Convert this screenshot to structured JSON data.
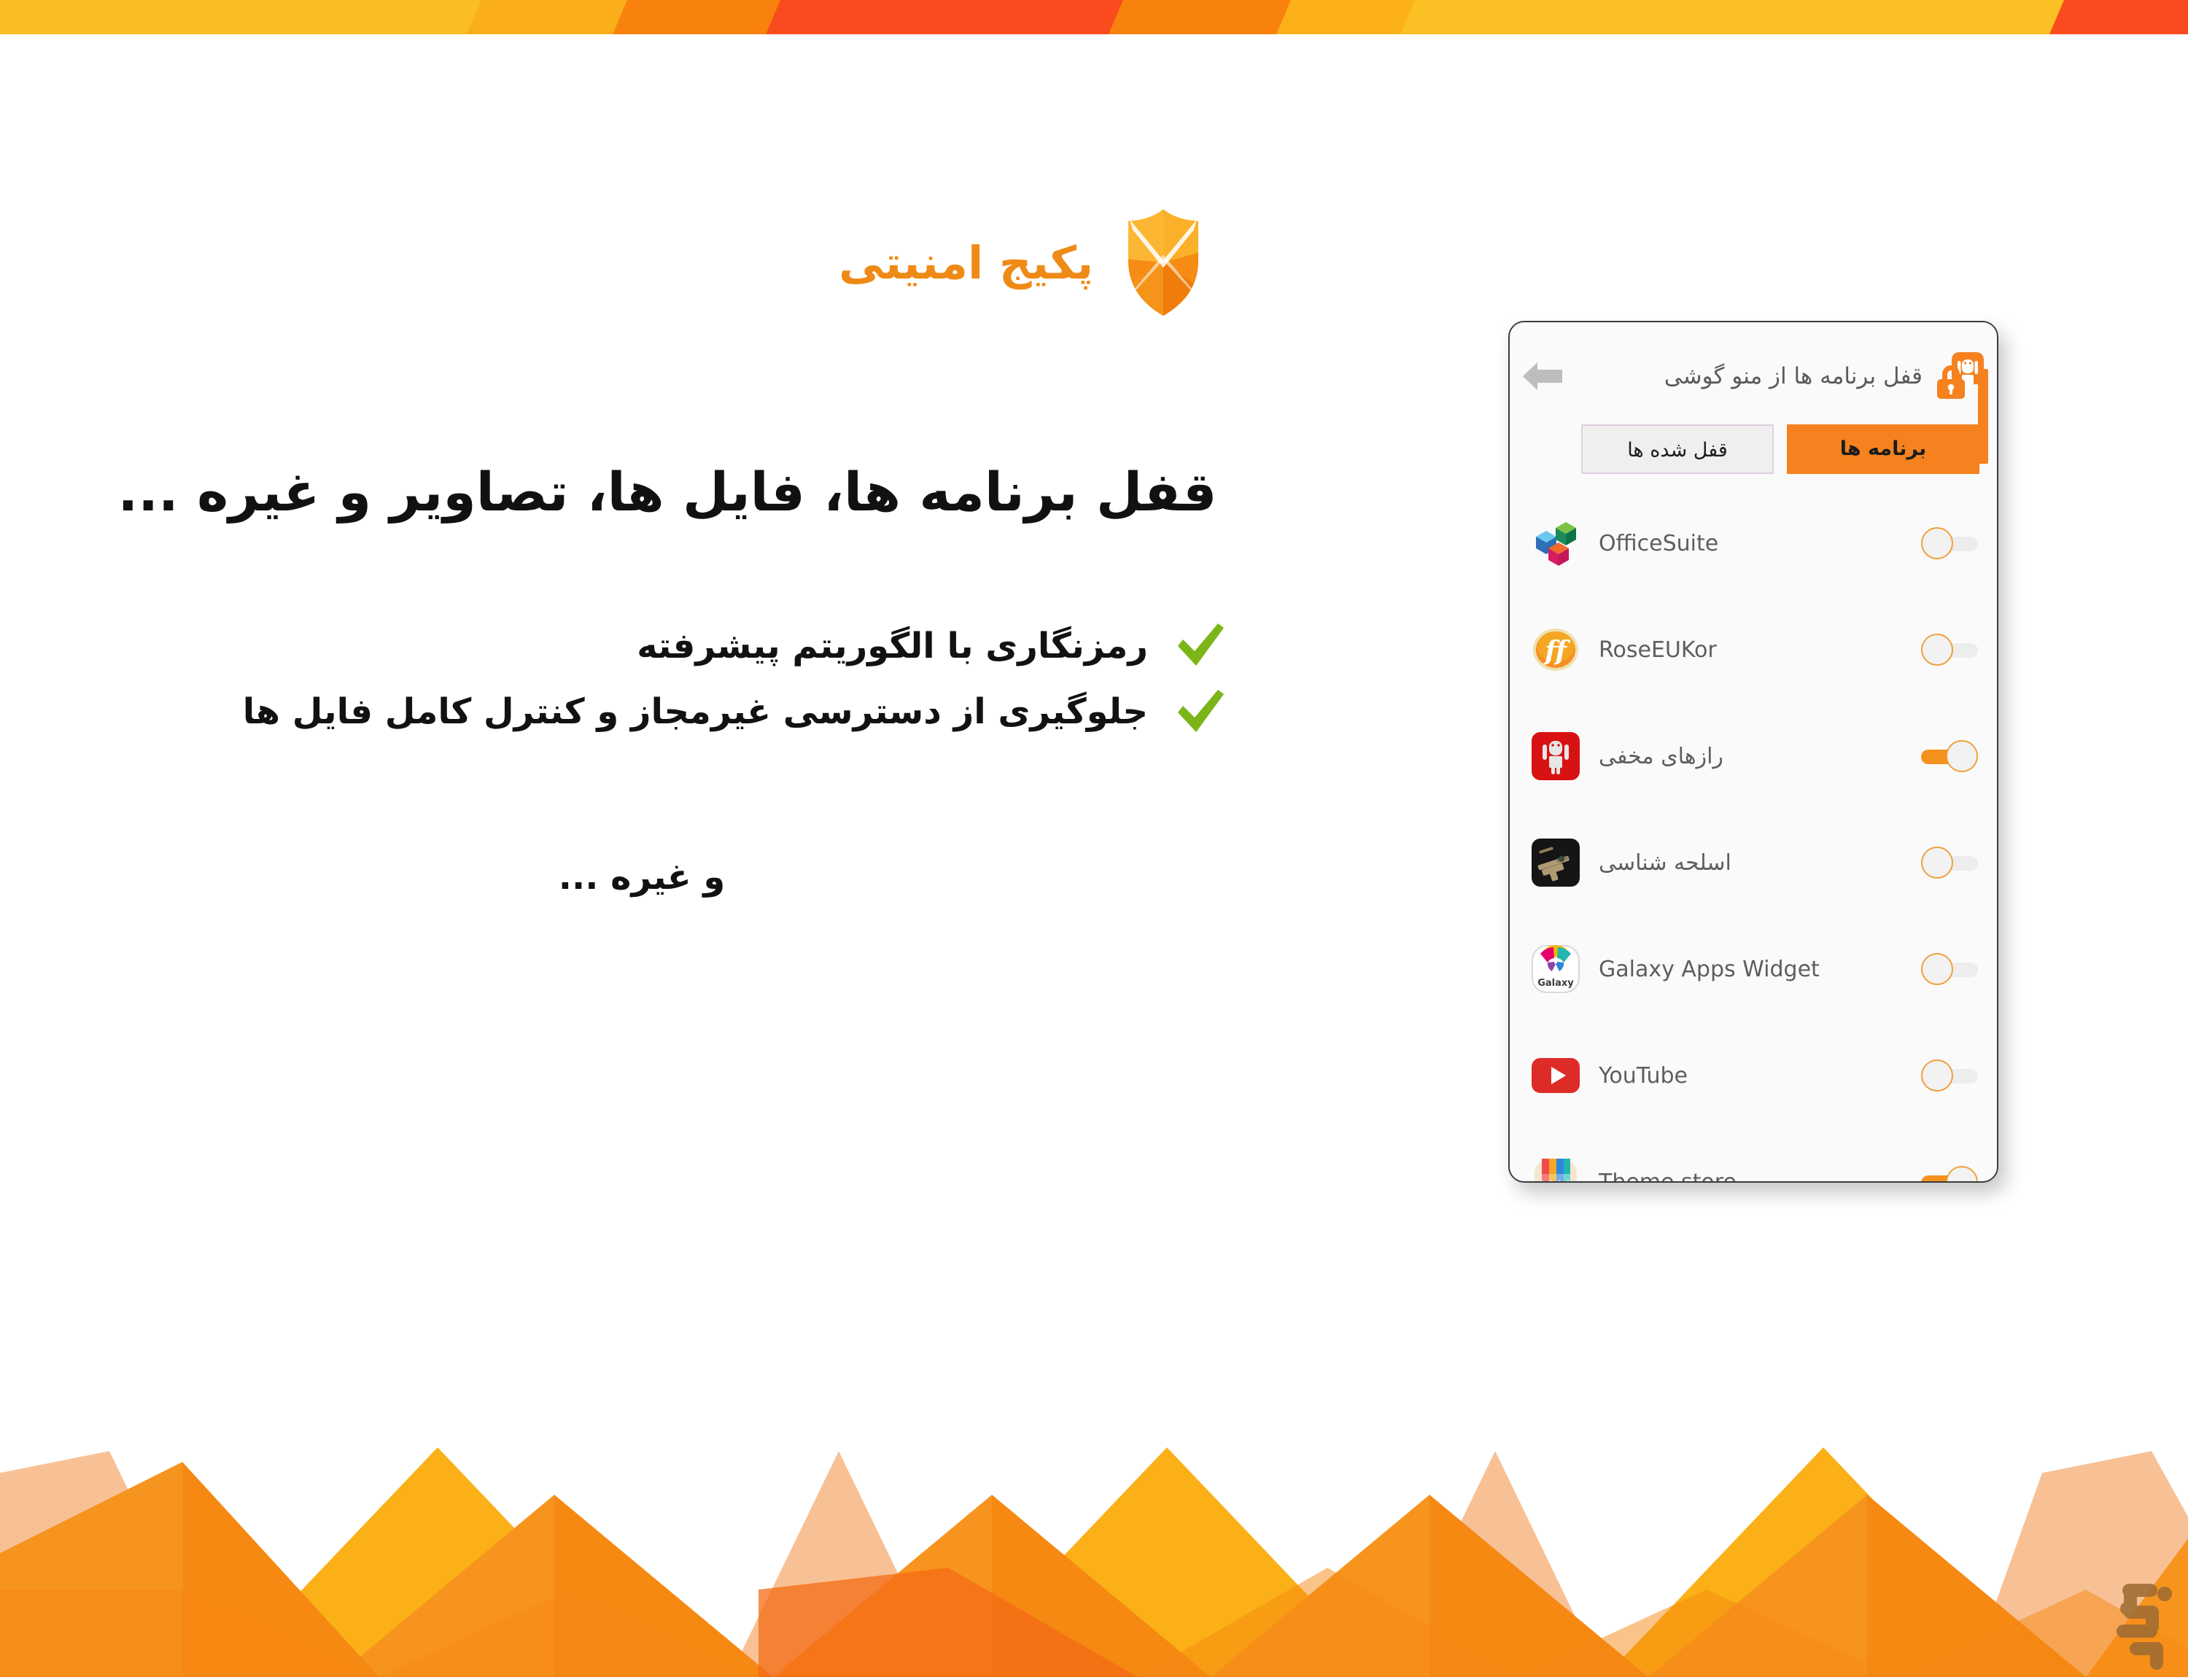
{
  "brand": {
    "title": "پکیج امنیتی",
    "logo_icon": "shield-x-icon",
    "accent_color": "#F08A16"
  },
  "headline": "قفل برنامه ها، فایل ها، تصاویر و غیره ...",
  "features": [
    {
      "icon": "check-icon",
      "text": "رمزنگاری با الگوریتم پیشرفته"
    },
    {
      "icon": "check-icon",
      "text": "جلوگیری از دسترسی غیرمجاز و کنترل کامل فایل ها"
    }
  ],
  "etc_text": "و غیره ...",
  "phone": {
    "header": {
      "title": "قفل برنامه ها از منو گوشی",
      "app_icon": "android-lock-icon",
      "back_icon": "back-arrow-icon"
    },
    "tabs": [
      {
        "label": "برنامه ها",
        "active": true
      },
      {
        "label": "قفل شده ها",
        "active": false
      }
    ],
    "apps": [
      {
        "name": "OfficeSuite",
        "icon": "officesuite-icon",
        "rtl": false,
        "locked": false
      },
      {
        "name": "RoseEUKor",
        "icon": "roseeukor-icon",
        "rtl": false,
        "locked": false
      },
      {
        "name": "رازهای مخفی",
        "icon": "android-red-icon",
        "rtl": true,
        "locked": true
      },
      {
        "name": "اسلحه شناسی",
        "icon": "weapon-photo-icon",
        "rtl": true,
        "locked": false
      },
      {
        "name": "Galaxy Apps Widget",
        "icon": "galaxy-apps-icon",
        "rtl": false,
        "locked": false
      },
      {
        "name": "YouTube",
        "icon": "youtube-icon",
        "rtl": false,
        "locked": false
      },
      {
        "name": "Theme store",
        "icon": "theme-store-icon",
        "rtl": false,
        "locked": true
      }
    ]
  },
  "colors": {
    "accent_orange": "#F5821F",
    "check_green": "#7CB518",
    "title_orange": "#F08A16",
    "toggle_on": "#F5921E"
  },
  "watermark": {
    "icon": "bazaar-logo-icon"
  }
}
